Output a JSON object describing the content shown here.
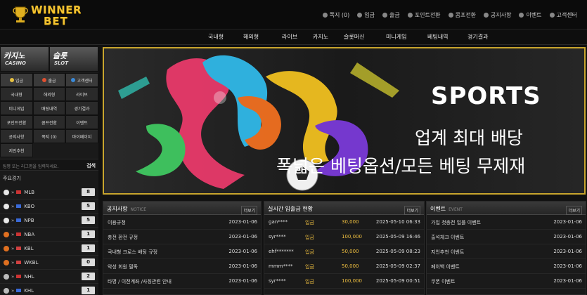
{
  "logo": {
    "line1": "WINNER",
    "line2": "BET"
  },
  "util_links": [
    {
      "icon": "mail-icon",
      "label": "쪽지 (0)"
    },
    {
      "icon": "login-icon",
      "label": "입금"
    },
    {
      "icon": "withdraw-icon",
      "label": "출금"
    },
    {
      "icon": "point-icon",
      "label": "포인트전환"
    },
    {
      "icon": "comp-icon",
      "label": "콤프전환"
    },
    {
      "icon": "notice-icon",
      "label": "공지사항"
    },
    {
      "icon": "event-icon",
      "label": "이벤트"
    },
    {
      "icon": "support-icon",
      "label": "고객센터"
    }
  ],
  "nav": [
    "국내형",
    "해외형",
    "라이브",
    "카지노",
    "슬롯머신",
    "미니게임",
    "베팅내역",
    "경기결과"
  ],
  "side": {
    "casino": {
      "title": "카지노",
      "sub": "CASINO"
    },
    "slot": {
      "title": "슬롯",
      "sub": "SLOT"
    },
    "grid": [
      "입금",
      "출금",
      "고객센터",
      "국내형",
      "해외형",
      "라이브",
      "미니게임",
      "배팅내역",
      "경기결과",
      "포인트전환",
      "콤프전환",
      "이벤트",
      "공지사항",
      "쪽지 (0)",
      "마이페이지",
      "지인추천"
    ],
    "search_placeholder": "팀명 또는 리그명을 입력하세요.",
    "search_button": "검색",
    "majors_title": "주요경기",
    "leagues": [
      {
        "name": "MLB",
        "count": "8",
        "ball": "#e8e8e8",
        "flag": "#c33"
      },
      {
        "name": "KBO",
        "count": "5",
        "ball": "#e8e8e8",
        "flag": "#3a6ad8"
      },
      {
        "name": "NPB",
        "count": "5",
        "ball": "#e8e8e8",
        "flag": "#3a6ad8"
      },
      {
        "name": "NBA",
        "count": "1",
        "ball": "#e07020",
        "flag": "#c33"
      },
      {
        "name": "KBL",
        "count": "1",
        "ball": "#e07020",
        "flag": "#d04040"
      },
      {
        "name": "WKBL",
        "count": "0",
        "ball": "#e07020",
        "flag": "#d04040"
      },
      {
        "name": "NHL",
        "count": "2",
        "ball": "#bbbbbb",
        "flag": "#c33"
      },
      {
        "name": "KHL",
        "count": "1",
        "ball": "#bbbbbb",
        "flag": "#3a6ad8"
      }
    ]
  },
  "banner": {
    "t1": "SPORTS",
    "t2": "업계 최대 배당",
    "t3": "폭넓은 베팅옵션/모든 베팅 무제재"
  },
  "notice": {
    "title": "공지사항",
    "sub": "NOTICE",
    "more": "더보기",
    "rows": [
      {
        "t": "이용규정",
        "d": "2023-01-06"
      },
      {
        "t": "충전 환전 규정",
        "d": "2023-01-06"
      },
      {
        "t": "국내형 크로스 배팅 규정",
        "d": "2023-01-06"
      },
      {
        "t": "악성 회원 필독",
        "d": "2023-01-06"
      },
      {
        "t": "타명 / 이전계좌 /사칭관련 안내",
        "d": "2023-01-06"
      }
    ]
  },
  "realtime": {
    "title": "실시간 입출금 현황",
    "more": "더보기",
    "rows": [
      {
        "u": "gan****",
        "k": "입금",
        "m": "30,000",
        "d": "2025-05-10 06:33"
      },
      {
        "u": "syr****",
        "k": "입금",
        "m": "100,000",
        "d": "2025-05-09 16:46"
      },
      {
        "u": "ehf*******",
        "k": "입금",
        "m": "50,000",
        "d": "2025-05-09 08:23"
      },
      {
        "u": "mmm****",
        "k": "입금",
        "m": "50,000",
        "d": "2025-05-09 02:37"
      },
      {
        "u": "syr****",
        "k": "입금",
        "m": "100,000",
        "d": "2025-05-09 00:51"
      }
    ]
  },
  "event": {
    "title": "이벤트",
    "sub": "EVENT",
    "more": "더보기",
    "rows": [
      {
        "t": "가입 첫충전 입플 이벤트",
        "d": "2023-01-06"
      },
      {
        "t": "출석체크 이벤트",
        "d": "2023-01-06"
      },
      {
        "t": "지인추천 이벤트",
        "d": "2023-01-06"
      },
      {
        "t": "페이백 이벤트",
        "d": "2023-01-06"
      },
      {
        "t": "쿠폰 이벤트",
        "d": "2023-01-06"
      }
    ]
  },
  "colors": {
    "accent": "#f2c230",
    "banner_border": "#c8a52d",
    "bg": "#111111"
  }
}
